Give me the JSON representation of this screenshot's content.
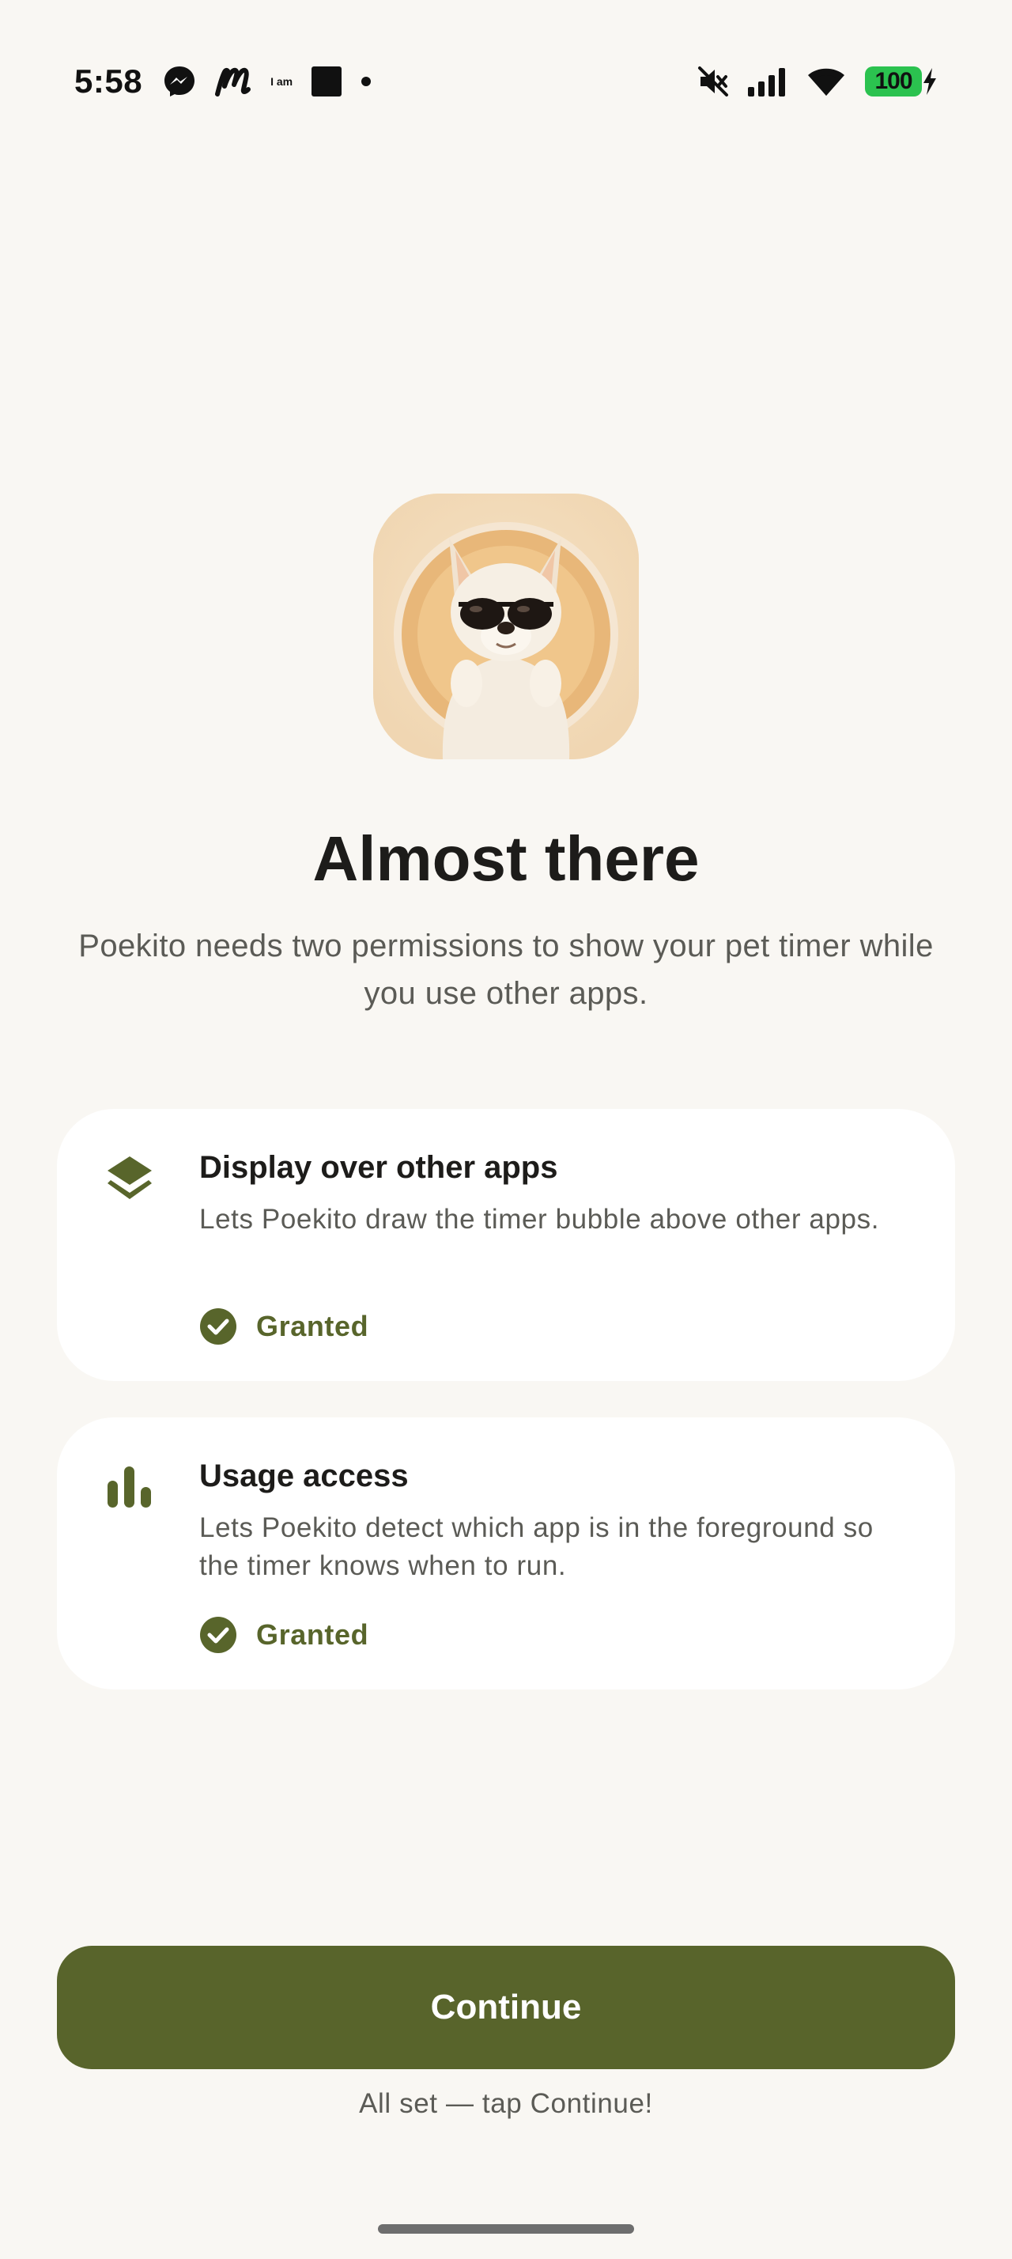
{
  "status_bar": {
    "time": "5:58",
    "notification_icons": [
      "messenger-icon",
      "m-logo-icon",
      "i-am-icon",
      "square-icon",
      "dot-icon"
    ],
    "i_am_label": "I am",
    "right_icons": [
      "mute-icon",
      "signal-icon",
      "wifi-icon"
    ],
    "battery_level": "100",
    "battery_color": "#2bc24f"
  },
  "header": {
    "app_icon": "chihuahua-sunglasses-icon",
    "title": "Almost there",
    "subtitle": "Poekito needs two permissions to show your pet timer while you use other apps."
  },
  "permissions": [
    {
      "icon": "layers-icon",
      "title": "Display over other apps",
      "description": "Lets Poekito draw the timer bubble above other apps.",
      "status": "Granted"
    },
    {
      "icon": "bar-chart-icon",
      "title": "Usage access",
      "description": "Lets Poekito detect which app is in the foreground so the timer knows when to run.",
      "status": "Granted"
    }
  ],
  "footer": {
    "continue_label": "Continue",
    "hint": "All set — tap Continue!"
  },
  "colors": {
    "background": "#f9f7f3",
    "accent": "#58642b",
    "card": "#ffffff",
    "text_secondary": "#5b5b56"
  }
}
